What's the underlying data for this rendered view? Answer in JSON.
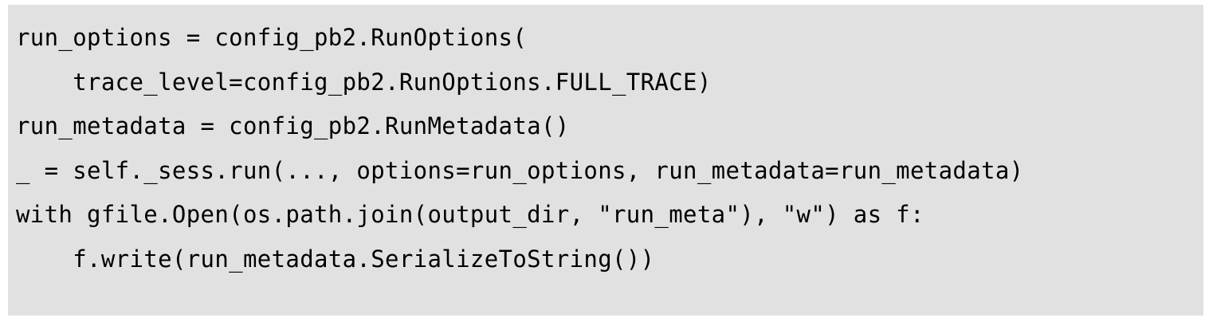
{
  "code": {
    "lines": [
      "run_options = config_pb2.RunOptions(",
      "    trace_level=config_pb2.RunOptions.FULL_TRACE)",
      "run_metadata = config_pb2.RunMetadata()",
      "_ = self._sess.run(..., options=run_options, run_metadata=run_metadata)",
      "with gfile.Open(os.path.join(output_dir, \"run_meta\"), \"w\") as f:",
      "    f.write(run_metadata.SerializeToString())"
    ]
  }
}
